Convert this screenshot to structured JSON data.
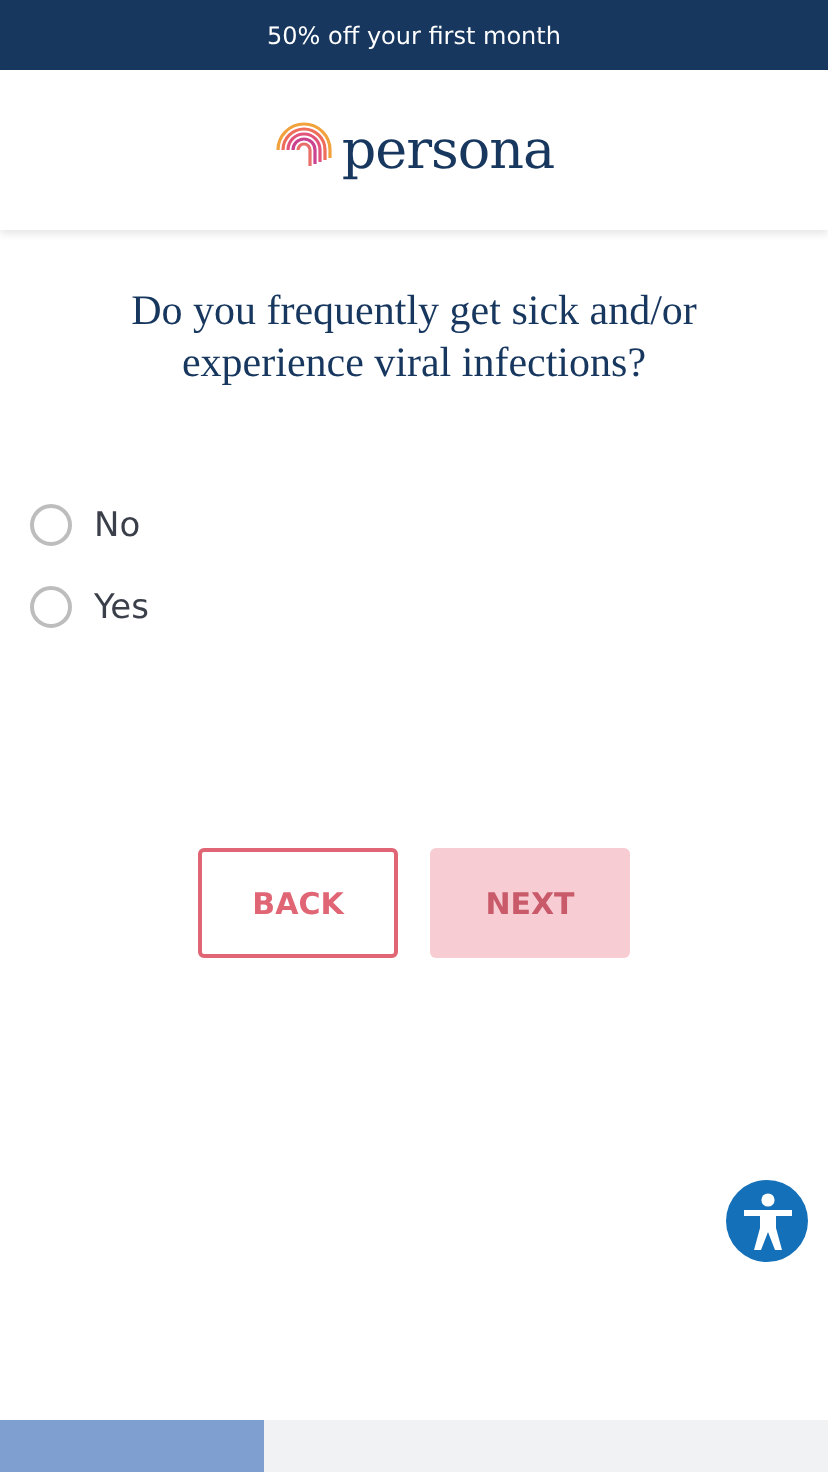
{
  "banner": {
    "text": "50% off your first month"
  },
  "header": {
    "logo_text": "persona"
  },
  "question": {
    "text": "Do you frequently get sick and/or experience viral infections?"
  },
  "options": [
    {
      "label": "No",
      "selected": false
    },
    {
      "label": "Yes",
      "selected": false
    }
  ],
  "buttons": {
    "back": {
      "label": "BACK",
      "disabled": false
    },
    "next": {
      "label": "NEXT",
      "disabled": true
    }
  },
  "progress": {
    "level": 0.32
  }
}
